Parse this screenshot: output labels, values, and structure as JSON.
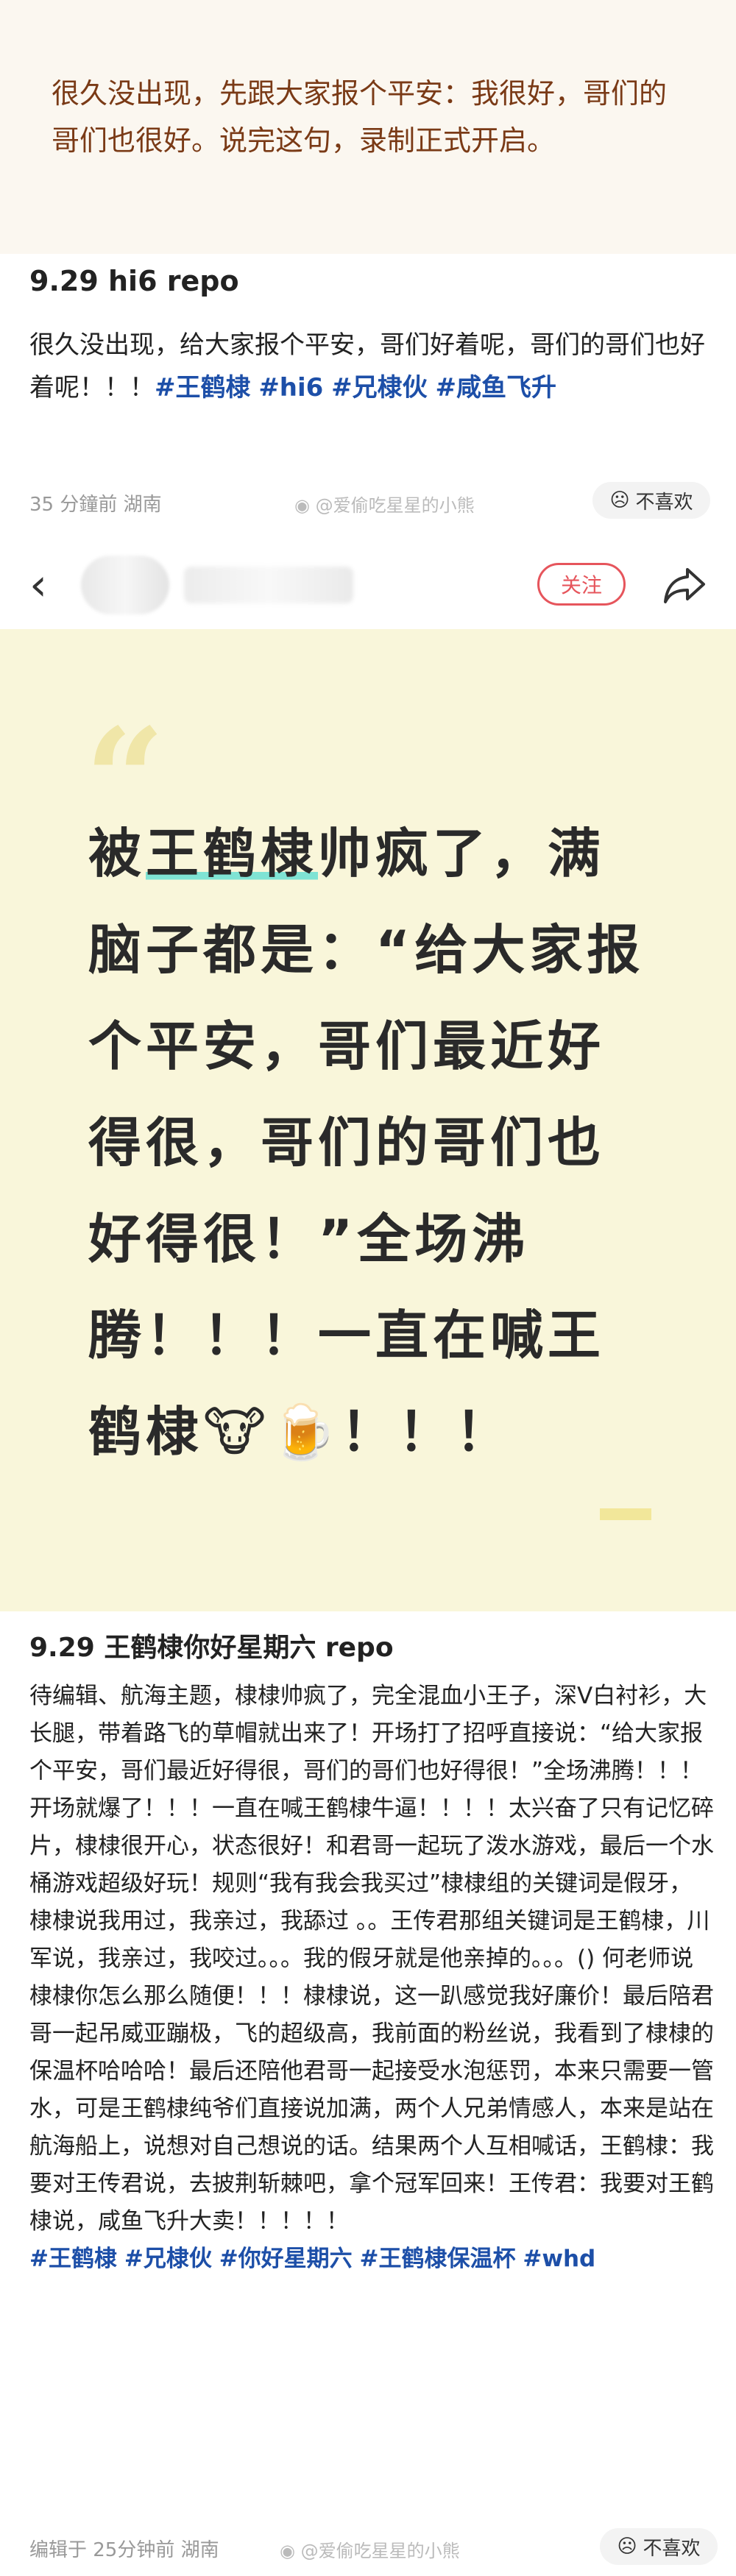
{
  "quote_top": {
    "text": "很久没出现，先跟大家报个平安：我很好，哥们的哥们也很好。说完这句，录制正式开启。"
  },
  "post1": {
    "title": "9.29 hi6 repo",
    "body": "很久没出现，给大家报个平安，哥们好着呢，哥们的哥们也好着呢！！！",
    "tags": [
      "#王鹤棣",
      "#hi6",
      "#兄棣伙",
      "#咸鱼飞升"
    ],
    "meta": "35 分鐘前  湖南",
    "watermark": "@爱偷吃星星的小熊",
    "dislike_label": "不喜欢"
  },
  "navbar": {
    "back_icon": "chevron-left-icon",
    "follow_label": "关注",
    "share_icon": "share-icon"
  },
  "card": {
    "quote_mark": "“",
    "highlight": "王鹤棣",
    "text_before": "被",
    "text_after": "帅疯了，满脑子都是：“给大家报个平安，哥们最近好得很，哥们的哥们也好得很！”全场沸腾！！！一直在喊王鹤棣🐮🍺！！！"
  },
  "post2": {
    "title": "9.29 王鹤棣你好星期六 repo",
    "body": "待编辑、航海主题，棣棣帅疯了，完全混血小王子，深V白衬衫，大长腿，带着路飞的草帽就出来了！开场打了招呼直接说：“给大家报个平安，哥们最近好得很，哥们的哥们也好得很！”全场沸腾！！！开场就爆了！！！一直在喊王鹤棣牛逼！！！！太兴奋了只有记忆碎片，棣棣很开心，状态很好！和君哥一起玩了泼水游戏，最后一个水桶游戏超级好玩！规则“我有我会我买过”棣棣组的关键词是假牙，棣棣说我用过，我亲过，我舔过 。。王传君那组关键词是王鹤棣，川军说，我亲过，我咬过。。。我的假牙就是他亲掉的。。。() 何老师说棣棣你怎么那么随便！！！棣棣说，这一趴感觉我好廉价！最后陪君哥一起吊威亚蹦极，飞的超级高，我前面的粉丝说，我看到了棣棣的保温杯哈哈哈！最后还陪他君哥一起接受水泡惩罚，本来只需要一管水，可是王鹤棣纯爷们直接说加满，两个人兄弟情感人，本来是站在航海船上，说想对自己想说的话。结果两个人互相喊话，王鹤棣：我要对王传君说，去披荆斩棘吧，拿个冠军回来！王传君：我要对王鹤棣说，咸鱼飞升大卖！！！！！",
    "tags": [
      "#王鹤棣",
      "#兄棣伙",
      "#你好星期六",
      "#王鹤棣保温杯",
      "#whd"
    ],
    "meta": "编辑于 25分钟前  湖南",
    "watermark": "@爱偷吃星星的小熊",
    "dislike_label": "不喜欢"
  }
}
